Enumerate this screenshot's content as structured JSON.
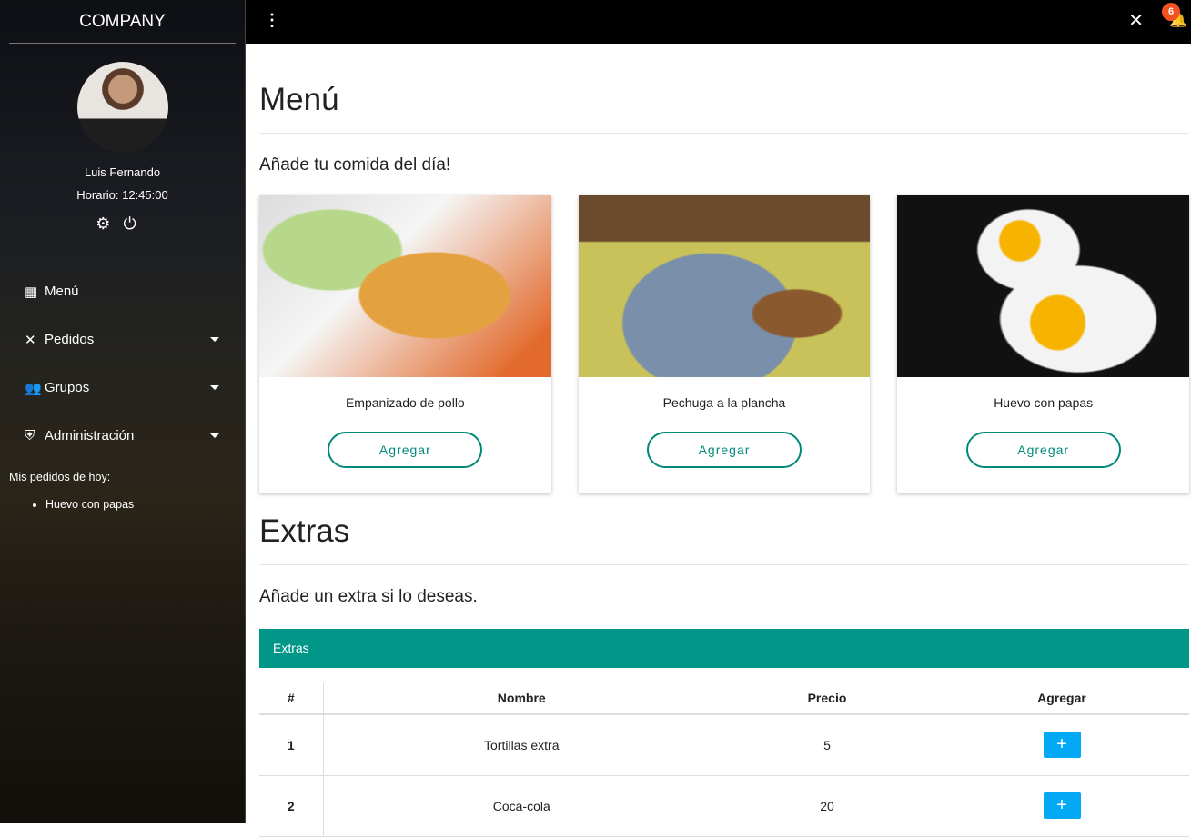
{
  "sidebar": {
    "brand": "COMPANY",
    "user_name": "Luis Fernando",
    "schedule": "Horario: 12:45:00",
    "nav": [
      {
        "label": "Menú",
        "icon": "dashboard-icon"
      },
      {
        "label": "Pedidos",
        "icon": "utensils-icon"
      },
      {
        "label": "Grupos",
        "icon": "group-icon"
      },
      {
        "label": "Administración",
        "icon": "shield-icon"
      }
    ],
    "today_title": "Mis pedidos de hoy:",
    "today_items": [
      "Huevo con papas"
    ]
  },
  "topbar": {
    "notifications": "6"
  },
  "menu": {
    "title": "Menú",
    "subtitle": "Añade tu comida del día!",
    "cards": [
      {
        "name": "Empanizado de pollo",
        "button": "Agregar"
      },
      {
        "name": "Pechuga a la plancha",
        "button": "Agregar"
      },
      {
        "name": "Huevo con papas",
        "button": "Agregar"
      }
    ]
  },
  "extras": {
    "title": "Extras",
    "subtitle": "Añade un extra si lo deseas.",
    "table_title": "Extras",
    "columns": [
      "#",
      "Nombre",
      "Precio",
      "Agregar"
    ],
    "rows": [
      {
        "n": "1",
        "name": "Tortillas extra",
        "price": "5",
        "add": "+"
      },
      {
        "n": "2",
        "name": "Coca-cola",
        "price": "20",
        "add": "+"
      }
    ]
  },
  "colors": {
    "accent": "#009688",
    "add_button": "#03a9f4",
    "badge": "#f4511e"
  }
}
